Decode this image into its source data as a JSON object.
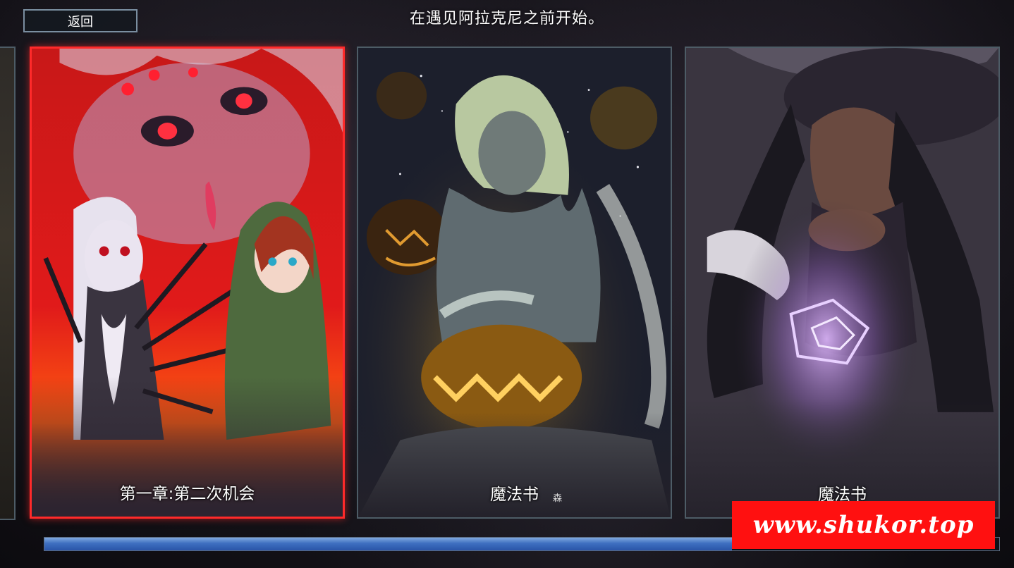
{
  "header": {
    "back_label": "返回",
    "title": "在遇见阿拉克尼之前开始。"
  },
  "cards": [
    {
      "label": "第一章:第二次机会",
      "selected": true,
      "theme": "spider-queen-red"
    },
    {
      "label": "魔法书",
      "selected": false,
      "theme": "pumpkin-night"
    },
    {
      "label": "魔法书",
      "selected": false,
      "theme": "witch-purple"
    }
  ],
  "extra_glyph": "森",
  "progress": {
    "fraction": 0.72,
    "color": "#3e6fc0"
  },
  "watermark": {
    "text": "www.shukor.top",
    "color": "#ff1010"
  },
  "colors": {
    "selected_border": "#ff2a2a",
    "card_border": "#4d5c66"
  }
}
